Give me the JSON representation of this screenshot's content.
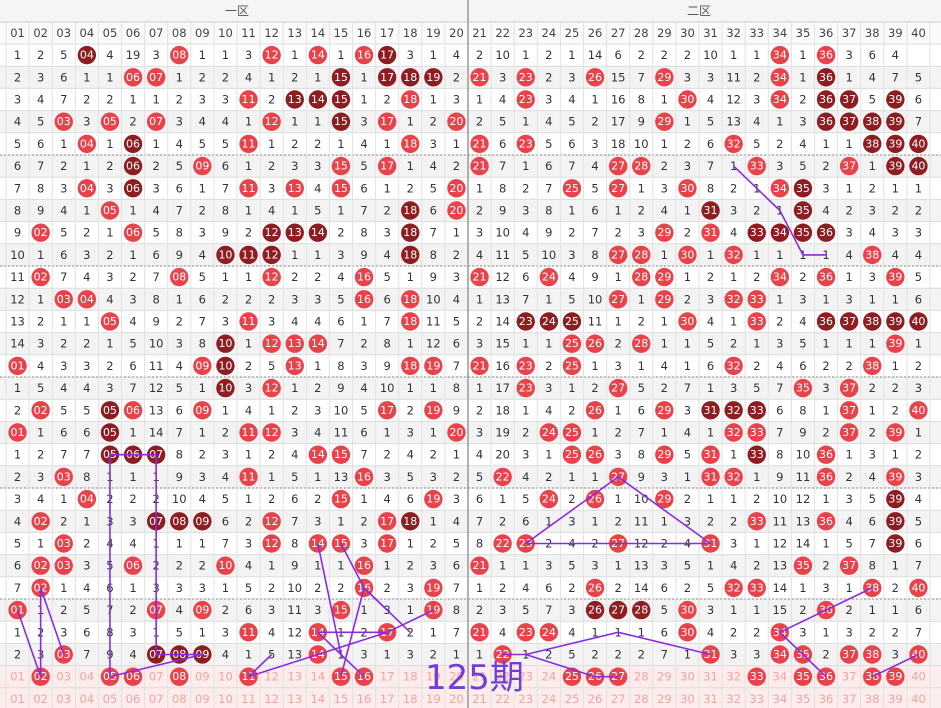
{
  "zones": [
    {
      "label": "一区"
    },
    {
      "label": "二区"
    }
  ],
  "headers": [
    "01",
    "02",
    "03",
    "04",
    "05",
    "06",
    "07",
    "08",
    "09",
    "10",
    "11",
    "12",
    "13",
    "14",
    "15",
    "16",
    "17",
    "18",
    "19",
    "20",
    "21",
    "22",
    "23",
    "24",
    "25",
    "26",
    "27",
    "28",
    "29",
    "30",
    "31",
    "32",
    "33",
    "34",
    "35",
    "36",
    "37",
    "38",
    "39",
    "40"
  ],
  "colors": {
    "hit": "#e8434a",
    "hit_dark": "#8e1d21",
    "line": "#8a2be2",
    "missing": "#333333",
    "stripe": "#f3f3f3",
    "period_bg": "#fdecec",
    "period_text": "#f1a3a3",
    "watermark": "#6f3fd6"
  },
  "watermark": "125期",
  "rows": [
    [
      1,
      2,
      5,
      "D",
      4,
      19,
      3,
      "H",
      1,
      1,
      3,
      "H",
      1,
      "H",
      1,
      "H",
      "D",
      3,
      1,
      4,
      2,
      10,
      1,
      2,
      1,
      14,
      6,
      2,
      2,
      2,
      10,
      1,
      1,
      "H",
      1,
      "H",
      3,
      6,
      4
    ],
    [
      2,
      3,
      6,
      1,
      1,
      "H",
      "H",
      1,
      2,
      2,
      4,
      1,
      2,
      1,
      "D",
      1,
      "D",
      "D",
      "D",
      2,
      "H",
      3,
      "H",
      2,
      3,
      "H",
      15,
      7,
      "H",
      3,
      3,
      11,
      2,
      "H",
      1,
      "D",
      1,
      4,
      7,
      5
    ],
    [
      3,
      4,
      7,
      2,
      2,
      1,
      1,
      2,
      3,
      3,
      "H",
      2,
      "D",
      "D",
      "D",
      1,
      2,
      "H",
      1,
      3,
      1,
      4,
      "H",
      3,
      4,
      1,
      16,
      8,
      1,
      "H",
      4,
      12,
      3,
      "H",
      2,
      "D",
      "D",
      5,
      "D",
      6
    ],
    [
      4,
      5,
      "H",
      3,
      "H",
      2,
      "H",
      3,
      4,
      4,
      1,
      "H",
      1,
      1,
      "D",
      3,
      "H",
      1,
      2,
      "H",
      2,
      5,
      1,
      4,
      5,
      2,
      17,
      9,
      "H",
      1,
      5,
      13,
      4,
      1,
      3,
      "D",
      "D",
      "D",
      "D",
      7
    ],
    [
      5,
      6,
      1,
      "H",
      1,
      "D",
      1,
      4,
      5,
      5,
      "H",
      1,
      2,
      2,
      1,
      4,
      1,
      "H",
      3,
      1,
      "H",
      6,
      "H",
      5,
      6,
      3,
      18,
      10,
      1,
      2,
      6,
      "H",
      5,
      2,
      4,
      1,
      1,
      "D",
      "D",
      "D"
    ],
    [
      6,
      7,
      2,
      1,
      2,
      "D",
      2,
      5,
      "H",
      6,
      1,
      2,
      3,
      3,
      "H",
      5,
      "H",
      1,
      4,
      2,
      "H",
      7,
      1,
      6,
      7,
      4,
      "H",
      "H",
      2,
      3,
      7,
      1,
      "H",
      3,
      5,
      2,
      "H",
      1,
      "D",
      "D"
    ],
    [
      7,
      8,
      3,
      "H",
      3,
      "D",
      3,
      6,
      1,
      7,
      "H",
      3,
      "H",
      4,
      "H",
      6,
      1,
      2,
      5,
      "H",
      1,
      8,
      2,
      7,
      "H",
      5,
      "H",
      1,
      3,
      "H",
      8,
      2,
      1,
      "H",
      "D",
      3,
      1,
      2,
      1,
      1
    ],
    [
      8,
      9,
      4,
      1,
      "H",
      1,
      4,
      7,
      2,
      8,
      1,
      4,
      1,
      5,
      1,
      7,
      2,
      "D",
      6,
      "H",
      2,
      9,
      3,
      8,
      1,
      6,
      1,
      2,
      4,
      1,
      "D",
      3,
      2,
      1,
      "D",
      4,
      2,
      3,
      2,
      2
    ],
    [
      9,
      "H",
      5,
      2,
      1,
      "H",
      5,
      8,
      3,
      9,
      2,
      "D",
      "D",
      "D",
      2,
      8,
      3,
      "D",
      7,
      1,
      3,
      10,
      4,
      9,
      2,
      7,
      2,
      3,
      "H",
      2,
      "H",
      4,
      "D",
      "D",
      "D",
      "D",
      3,
      4,
      3,
      3
    ],
    [
      10,
      1,
      6,
      3,
      2,
      1,
      6,
      9,
      4,
      "D",
      "D",
      "D",
      1,
      1,
      3,
      9,
      4,
      "D",
      8,
      2,
      4,
      11,
      5,
      10,
      3,
      8,
      "H",
      "H",
      1,
      "H",
      1,
      "H",
      1,
      1,
      1,
      1,
      4,
      "H",
      4,
      4
    ],
    [
      11,
      "H",
      7,
      4,
      3,
      2,
      7,
      "H",
      5,
      1,
      1,
      "H",
      2,
      2,
      4,
      "H",
      5,
      1,
      9,
      3,
      "H",
      12,
      6,
      "H",
      4,
      9,
      1,
      "H",
      "H",
      1,
      2,
      1,
      2,
      "H",
      2,
      "H",
      1,
      3,
      "H",
      5
    ],
    [
      12,
      1,
      "H",
      "H",
      4,
      3,
      8,
      1,
      6,
      2,
      2,
      2,
      3,
      3,
      5,
      "H",
      6,
      "H",
      10,
      4,
      1,
      13,
      7,
      1,
      5,
      10,
      "H",
      1,
      "H",
      2,
      3,
      "H",
      "H",
      1,
      3,
      1,
      3,
      1,
      1,
      6
    ],
    [
      13,
      2,
      1,
      1,
      "H",
      4,
      9,
      2,
      7,
      3,
      "H",
      3,
      4,
      4,
      6,
      1,
      7,
      "H",
      11,
      5,
      2,
      14,
      "D",
      "D",
      "D",
      11,
      1,
      2,
      1,
      "H",
      4,
      1,
      "H",
      2,
      4,
      "D",
      "D",
      "D",
      "D",
      "D"
    ],
    [
      14,
      3,
      2,
      2,
      1,
      5,
      10,
      3,
      8,
      "D",
      1,
      "H",
      "H",
      "H",
      7,
      2,
      8,
      1,
      12,
      6,
      3,
      15,
      1,
      1,
      "H",
      "H",
      2,
      "H",
      1,
      1,
      5,
      2,
      1,
      3,
      5,
      1,
      1,
      1,
      "H",
      1
    ],
    [
      "H",
      4,
      3,
      3,
      2,
      6,
      11,
      4,
      "H",
      "D",
      2,
      5,
      "H",
      1,
      8,
      3,
      9,
      "H",
      "H",
      7,
      "H",
      16,
      "H",
      2,
      "H",
      1,
      3,
      1,
      4,
      1,
      6,
      "H",
      2,
      4,
      6,
      2,
      2,
      "H",
      1,
      2
    ],
    [
      1,
      5,
      4,
      4,
      3,
      7,
      12,
      5,
      1,
      "D",
      3,
      "H",
      1,
      2,
      9,
      4,
      10,
      1,
      1,
      8,
      1,
      17,
      "H",
      3,
      1,
      2,
      "H",
      5,
      2,
      7,
      1,
      3,
      5,
      7,
      "H",
      3,
      "H",
      2,
      2,
      3
    ],
    [
      2,
      "H",
      5,
      5,
      "D",
      "H",
      13,
      6,
      "H",
      1,
      4,
      1,
      2,
      3,
      10,
      5,
      "H",
      2,
      "H",
      9,
      2,
      18,
      1,
      4,
      2,
      "H",
      1,
      6,
      "H",
      3,
      "D",
      "D",
      "D",
      6,
      8,
      1,
      "H",
      1,
      2,
      "H"
    ],
    [
      "H",
      1,
      6,
      6,
      "D",
      1,
      14,
      7,
      1,
      2,
      "H",
      "H",
      3,
      4,
      11,
      6,
      1,
      3,
      1,
      "H",
      3,
      19,
      2,
      "H",
      "H",
      1,
      2,
      7,
      1,
      4,
      1,
      "H",
      "H",
      7,
      9,
      2,
      "H",
      2,
      "H",
      1
    ],
    [
      1,
      2,
      7,
      7,
      "D",
      "D",
      "D",
      8,
      2,
      3,
      1,
      2,
      4,
      "H",
      "H",
      7,
      2,
      4,
      2,
      1,
      4,
      20,
      3,
      1,
      "H",
      "H",
      3,
      8,
      "H",
      5,
      "H",
      1,
      "D",
      8,
      10,
      "H",
      1,
      3,
      1,
      2
    ],
    [
      2,
      3,
      "H",
      8,
      1,
      1,
      1,
      9,
      3,
      4,
      "H",
      1,
      5,
      1,
      13,
      "H",
      3,
      5,
      3,
      2,
      5,
      "H",
      4,
      2,
      1,
      1,
      "H",
      9,
      3,
      1,
      "H",
      "H",
      1,
      9,
      11,
      "H",
      2,
      4,
      "H",
      3
    ],
    [
      3,
      4,
      1,
      "H",
      2,
      2,
      2,
      10,
      4,
      5,
      1,
      2,
      6,
      2,
      "H",
      1,
      4,
      6,
      "H",
      3,
      6,
      1,
      5,
      "H",
      2,
      "H",
      1,
      10,
      "H",
      2,
      1,
      1,
      2,
      10,
      12,
      1,
      3,
      5,
      "D",
      4
    ],
    [
      4,
      "H",
      2,
      1,
      3,
      3,
      "D",
      "D",
      "D",
      6,
      2,
      "H",
      7,
      3,
      1,
      2,
      "H",
      "D",
      1,
      4,
      7,
      2,
      6,
      1,
      3,
      1,
      2,
      11,
      1,
      3,
      2,
      2,
      "H",
      11,
      13,
      "H",
      4,
      6,
      "D",
      5
    ],
    [
      5,
      1,
      "H",
      2,
      4,
      4,
      1,
      1,
      1,
      7,
      3,
      "H",
      8,
      "H",
      "H",
      3,
      "H",
      1,
      2,
      5,
      8,
      "H",
      "H",
      2,
      4,
      2,
      "H",
      12,
      2,
      4,
      "H",
      3,
      1,
      12,
      14,
      1,
      5,
      7,
      "D",
      6
    ],
    [
      6,
      "H",
      "H",
      3,
      5,
      "H",
      2,
      2,
      2,
      "H",
      4,
      1,
      9,
      1,
      1,
      "H",
      1,
      2,
      3,
      6,
      "H",
      1,
      1,
      3,
      5,
      3,
      1,
      13,
      3,
      5,
      1,
      4,
      2,
      13,
      "H",
      2,
      "H",
      8,
      1,
      7
    ],
    [
      7,
      "H",
      1,
      4,
      6,
      1,
      3,
      3,
      3,
      1,
      5,
      2,
      10,
      2,
      2,
      "H",
      2,
      3,
      "H",
      7,
      1,
      2,
      4,
      6,
      2,
      "H",
      2,
      14,
      6,
      2,
      5,
      "H",
      "H",
      14,
      1,
      3,
      1,
      "H",
      2,
      "H"
    ],
    [
      "H",
      1,
      2,
      5,
      7,
      2,
      "H",
      4,
      "H",
      2,
      6,
      3,
      11,
      3,
      "H",
      1,
      3,
      1,
      "H",
      8,
      2,
      3,
      5,
      7,
      3,
      "D",
      "D",
      "D",
      5,
      "H",
      3,
      1,
      1,
      15,
      2,
      "H",
      2,
      1,
      1,
      6
    ],
    [
      1,
      2,
      3,
      6,
      8,
      3,
      1,
      5,
      1,
      3,
      "H",
      4,
      12,
      "H",
      1,
      2,
      "H",
      2,
      1,
      7,
      "H",
      4,
      "H",
      "H",
      4,
      1,
      1,
      1,
      6,
      "H",
      4,
      2,
      2,
      "H",
      3,
      1,
      3,
      2,
      2,
      7
    ],
    [
      2,
      3,
      "H",
      7,
      9,
      4,
      "D",
      "D",
      "D",
      4,
      1,
      5,
      13,
      "H",
      1,
      3,
      1,
      3,
      2,
      1,
      1,
      "H",
      1,
      2,
      5,
      2,
      2,
      2,
      7,
      1,
      "H",
      3,
      3,
      "H",
      "H",
      2,
      "H",
      "H",
      3,
      "H"
    ]
  ],
  "period_row": [
    "01",
    "H",
    "03",
    "04",
    "H",
    "H",
    "07",
    "H",
    "09",
    "10",
    "H",
    "12",
    "13",
    "14",
    "H",
    "H",
    "17",
    "18",
    "19",
    "20",
    "21",
    "22",
    "23",
    "24",
    "H",
    "H",
    "H",
    "28",
    "29",
    "30",
    "31",
    "32",
    "H",
    "34",
    "H",
    "H",
    "37",
    "H",
    "H",
    "40"
  ],
  "ghost_row": [
    "01",
    "02",
    "03",
    "04",
    "05",
    "06",
    "07",
    "08",
    "09",
    "10",
    "11",
    "12",
    "13",
    "14",
    "15",
    "16",
    "17",
    "18",
    "19",
    "20",
    "21",
    "22",
    "23",
    "24",
    "25",
    "26",
    "27",
    "28",
    "29",
    "30",
    "31",
    "32",
    "33",
    "34",
    "35",
    "36",
    "37",
    "38",
    "39",
    "40"
  ]
}
